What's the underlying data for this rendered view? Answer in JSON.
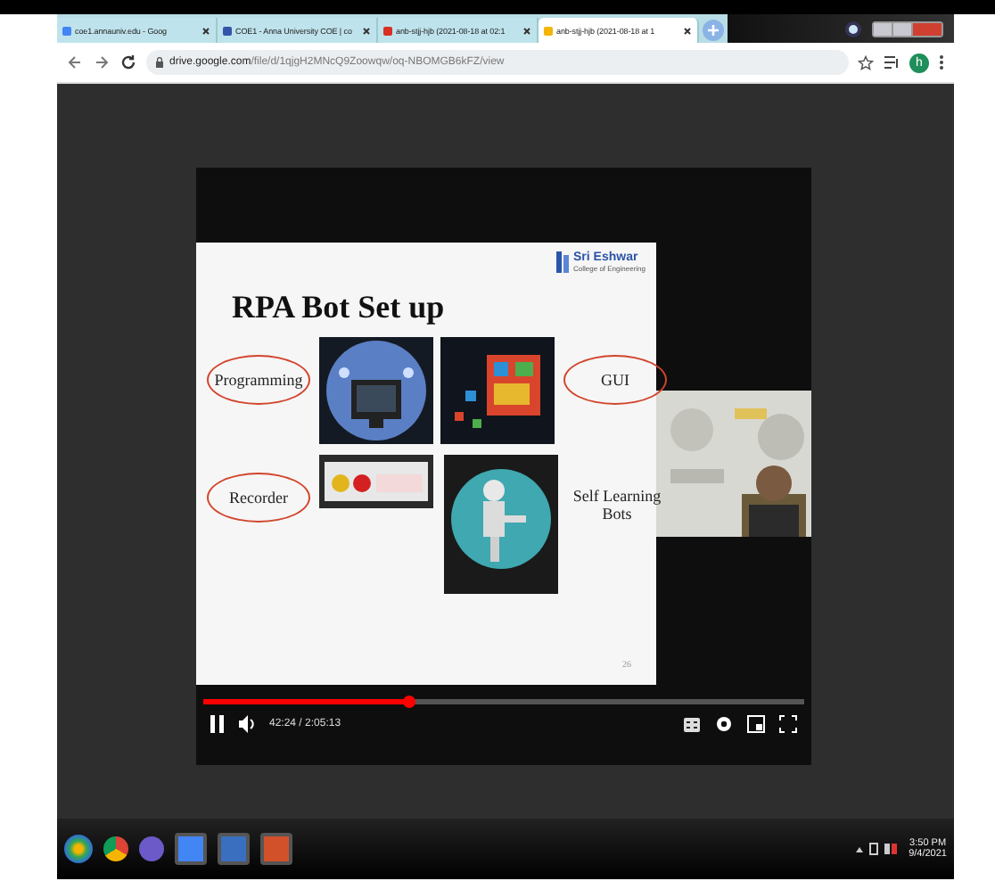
{
  "browser": {
    "tabs": [
      {
        "title": "coe1.annauniv.edu - Goog",
        "selected": false
      },
      {
        "title": "COE1 - Anna University COE | co",
        "selected": false
      },
      {
        "title": "anb-stjj-hjb (2021-08-18 at 02:1",
        "selected": false
      },
      {
        "title": "anb-stjj-hjb (2021-08-18 at 1",
        "selected": true
      }
    ],
    "address": {
      "host": "drive.google.com",
      "path": "/file/d/1qjgH2MNcQ9Zoowqw/oq-NBOMGB6kFZ/view"
    },
    "profile": "h"
  },
  "slide": {
    "title": "RPA Bot Set up",
    "logo": {
      "name": "Sri Eshwar",
      "subtitle": "College of Engineering"
    },
    "items": [
      {
        "label": "Programming",
        "circled": true
      },
      {
        "label": "GUI",
        "circled": true
      },
      {
        "label": "Recorder",
        "circled": true
      },
      {
        "label": "Self Learning Bots",
        "circled": false
      }
    ],
    "page_number": "26"
  },
  "player": {
    "playing": true,
    "level": 0.34,
    "time": "42:24 / 2:05:13"
  },
  "taskbar": {
    "time": "3:50 PM",
    "date": "9/4/2021"
  }
}
